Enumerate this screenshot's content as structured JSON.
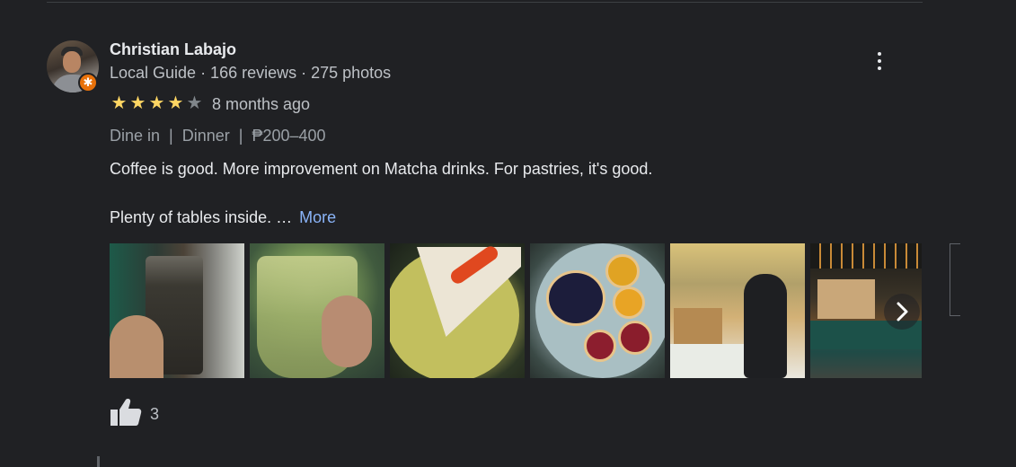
{
  "review": {
    "author": {
      "name": "Christian Labajo",
      "meta": "Local Guide · 166 reviews · 275 photos"
    },
    "badge_icon": "local-guide-star-icon",
    "rating": 4,
    "rating_max": 5,
    "time": "8 months ago",
    "tags": {
      "service": "Dine in",
      "meal": "Dinner",
      "price": "₱200–400",
      "separator": "|"
    },
    "text_line1": "Coffee is good. More improvement on Matcha drinks. For pastries, it's good.",
    "text_line2": "Plenty of tables inside. …",
    "more_label": "More",
    "photos": [
      {
        "subject": "iced-coffee-photo"
      },
      {
        "subject": "matcha-drink-photo"
      },
      {
        "subject": "carrot-cake-photo"
      },
      {
        "subject": "tarts-plate-photo"
      },
      {
        "subject": "cafe-counter-photo"
      },
      {
        "subject": "cafe-interior-photo"
      }
    ],
    "like_count": "3",
    "like_icon": "thumbs-up-icon",
    "menu_icon": "more-vert-icon",
    "next_icon": "chevron-right-icon"
  },
  "colors": {
    "background": "#202124",
    "star": "#fdd663",
    "link": "#8ab4f8",
    "badge": "#e8710a"
  }
}
